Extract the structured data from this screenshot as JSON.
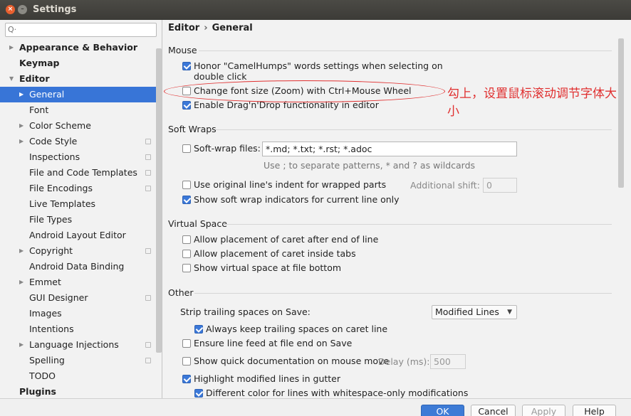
{
  "window": {
    "title": "Settings",
    "close_glyph": "×",
    "min_glyph": "–"
  },
  "search": {
    "icon": "search-icon",
    "glyph": "Q·"
  },
  "sidebar": {
    "items": [
      {
        "label": "Appearance & Behavior",
        "arrow": "▶"
      },
      {
        "label": "Keymap",
        "arrow": ""
      },
      {
        "label": "Editor",
        "arrow": "▼"
      },
      {
        "label": "General",
        "arrow": "▶"
      },
      {
        "label": "Font",
        "arrow": ""
      },
      {
        "label": "Color Scheme",
        "arrow": "▶"
      },
      {
        "label": "Code Style",
        "arrow": "▶"
      },
      {
        "label": "Inspections",
        "arrow": ""
      },
      {
        "label": "File and Code Templates",
        "arrow": ""
      },
      {
        "label": "File Encodings",
        "arrow": ""
      },
      {
        "label": "Live Templates",
        "arrow": ""
      },
      {
        "label": "File Types",
        "arrow": ""
      },
      {
        "label": "Android Layout Editor",
        "arrow": ""
      },
      {
        "label": "Copyright",
        "arrow": "▶"
      },
      {
        "label": "Android Data Binding",
        "arrow": ""
      },
      {
        "label": "Emmet",
        "arrow": "▶"
      },
      {
        "label": "GUI Designer",
        "arrow": ""
      },
      {
        "label": "Images",
        "arrow": ""
      },
      {
        "label": "Intentions",
        "arrow": ""
      },
      {
        "label": "Language Injections",
        "arrow": "▶"
      },
      {
        "label": "Spelling",
        "arrow": ""
      },
      {
        "label": "TODO",
        "arrow": ""
      },
      {
        "label": "Plugins",
        "arrow": ""
      }
    ]
  },
  "breadcrumb": {
    "parent": "Editor",
    "sep": "›",
    "current": "General"
  },
  "mouse": {
    "title": "Mouse",
    "camel_line1": "Honor \"CamelHumps\" words settings when selecting on",
    "camel_line2": "double click",
    "zoom": "Change font size (Zoom) with Ctrl+Mouse Wheel",
    "dnd": "Enable Drag'n'Drop functionality in editor"
  },
  "soft_wraps": {
    "title": "Soft Wraps",
    "files_label": "Soft-wrap files:",
    "files_value": "*.md; *.txt; *.rst; *.adoc",
    "hint": "Use ; to separate patterns, * and ? as wildcards",
    "indent": "Use original line's indent for wrapped parts",
    "shift_label": "Additional shift:",
    "shift_value": "0",
    "indicators": "Show soft wrap indicators for current line only"
  },
  "virtual_space": {
    "title": "Virtual Space",
    "after_eol": "Allow placement of caret after end of line",
    "inside_tabs": "Allow placement of caret inside tabs",
    "file_bottom": "Show virtual space at file bottom"
  },
  "other": {
    "title": "Other",
    "strip_label": "Strip trailing spaces on Save:",
    "strip_value": "Modified Lines",
    "keep_trailing": "Always keep trailing spaces on caret line",
    "ensure_lf": "Ensure line feed at file end on Save",
    "quick_doc": "Show quick documentation on mouse move",
    "delay_label": "Delay (ms):",
    "delay_value": "500",
    "highlight_modified": "Highlight modified lines in gutter",
    "diff_color": "Different color for lines with whitespace-only modifications"
  },
  "buttons": {
    "ok": "OK",
    "cancel": "Cancel",
    "apply": "Apply",
    "help": "Help"
  },
  "annotation": {
    "text": "勾上，设置鼠标滚动调节字体大小"
  },
  "colors": {
    "accent": "#3875d7",
    "annotation": "#e03030"
  }
}
